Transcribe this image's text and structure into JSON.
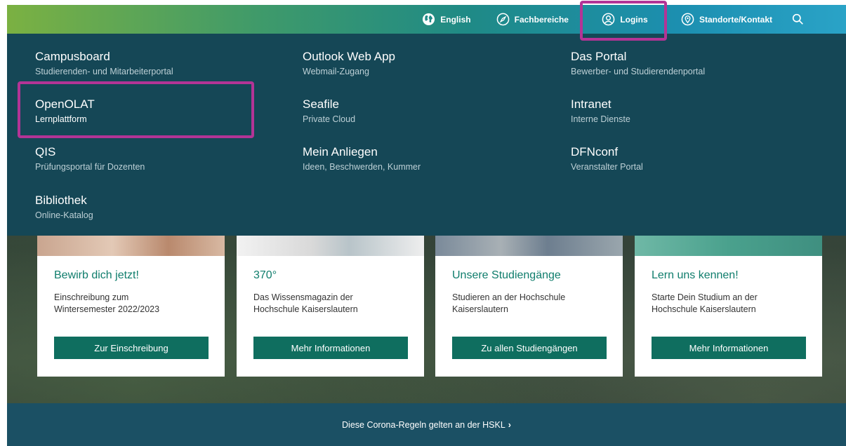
{
  "topnav": {
    "items": [
      {
        "label": "English",
        "icon": "globe-icon"
      },
      {
        "label": "Fachbereiche",
        "icon": "compass-icon"
      },
      {
        "label": "Logins",
        "icon": "user-icon"
      },
      {
        "label": "Standorte/Kontakt",
        "icon": "location-pin-icon"
      }
    ],
    "search_icon": "search-icon"
  },
  "dropdown": {
    "items": [
      {
        "title": "Campusboard",
        "subtitle": "Studierenden- und Mitarbeiterportal"
      },
      {
        "title": "Outlook Web App",
        "subtitle": "Webmail-Zugang"
      },
      {
        "title": "Das Portal",
        "subtitle": "Bewerber- und Studierendenportal"
      },
      {
        "title": "OpenOLAT",
        "subtitle": "Lernplattform"
      },
      {
        "title": "Seafile",
        "subtitle": "Private Cloud"
      },
      {
        "title": "Intranet",
        "subtitle": "Interne Dienste"
      },
      {
        "title": "QIS",
        "subtitle": "Prüfungsportal für Dozenten"
      },
      {
        "title": "Mein Anliegen",
        "subtitle": "Ideen, Beschwerden, Kummer"
      },
      {
        "title": "DFNconf",
        "subtitle": "Veranstalter Portal"
      },
      {
        "title": "Bibliothek",
        "subtitle": "Online-Katalog"
      }
    ]
  },
  "cards": [
    {
      "title": "Bewirb dich jetzt!",
      "desc1": "Einschreibung zum",
      "desc2": "Wintersemester 2022/2023",
      "button": "Zur Einschreibung"
    },
    {
      "title": "370°",
      "desc1": "Das Wissensmagazin der",
      "desc2": "Hochschule Kaiserslautern",
      "button": "Mehr Informationen"
    },
    {
      "title": "Unsere Studiengänge",
      "desc1": "Studieren an der Hochschule",
      "desc2": "Kaiserslautern",
      "button": "Zu allen Studiengängen"
    },
    {
      "title": "Lern uns kennen!",
      "desc1": "Starte Dein Studium an der",
      "desc2": "Hochschule Kaiserslautern",
      "button": "Mehr Informationen"
    }
  ],
  "banner": {
    "text": "Diese Corona-Regeln gelten an der HSKL",
    "chevron": "›"
  },
  "colors": {
    "dropdown_bg": "#154756",
    "highlight": "#b33496",
    "button_bg": "#0f6e5f",
    "card_title": "#0f7d6c",
    "banner_bg": "#1b5064"
  }
}
